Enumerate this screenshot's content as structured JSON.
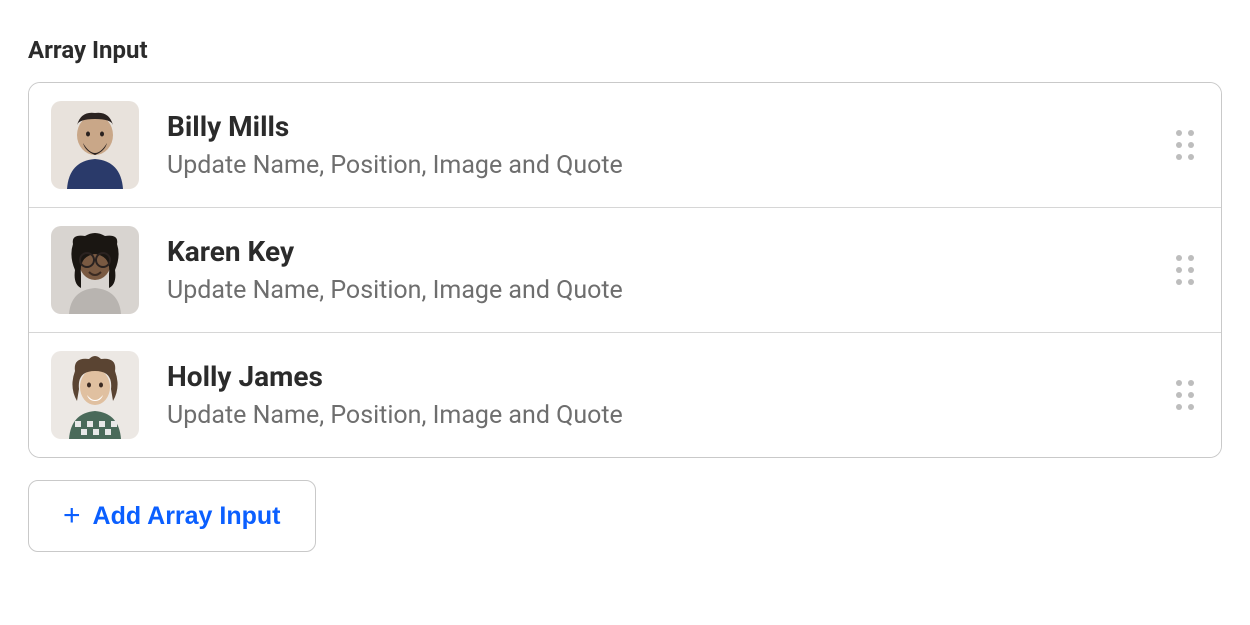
{
  "section": {
    "label": "Array Input"
  },
  "items": [
    {
      "name": "Billy Mills",
      "subtitle": "Update Name, Position, Image and Quote"
    },
    {
      "name": "Karen Key",
      "subtitle": "Update Name, Position, Image and Quote"
    },
    {
      "name": "Holly James",
      "subtitle": "Update Name, Position, Image and Quote"
    }
  ],
  "addButton": {
    "label": "Add Array Input",
    "plus": "+"
  }
}
